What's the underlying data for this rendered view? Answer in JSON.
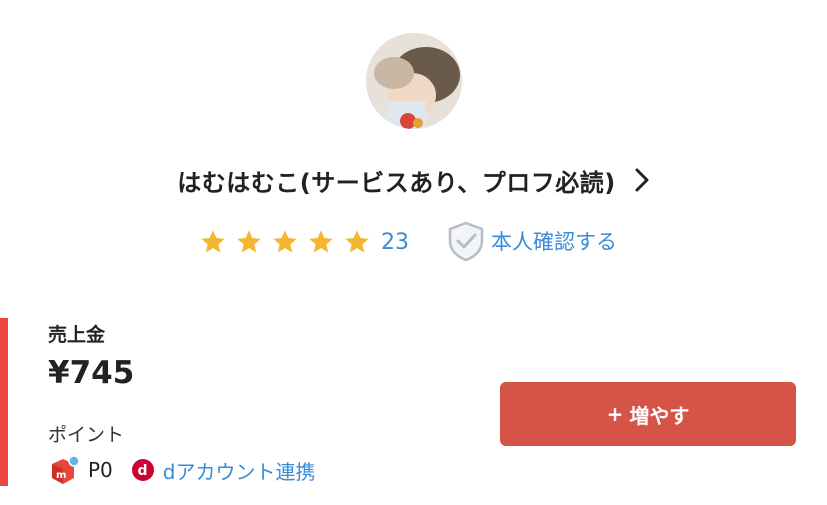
{
  "profile": {
    "avatar_alt": "profile-photo",
    "name": "はむはむこ(サービスあり、プロフ必読)",
    "chevron_icon": "chevron-right-icon"
  },
  "rating": {
    "stars": 5,
    "max_stars": 5,
    "count": "23",
    "star_color": "#f5b731"
  },
  "verification": {
    "icon": "shield-check-icon",
    "label": "本人確認する"
  },
  "sales": {
    "label": "売上金",
    "amount": "¥745"
  },
  "points": {
    "label": "ポイント",
    "icon": "mercari-m-icon",
    "value": "P0",
    "d_icon": "docomo-d-icon",
    "d_link": "dアカウント連携"
  },
  "actions": {
    "increase_plus": "+",
    "increase_label": "増やす",
    "button_color": "#d55347"
  },
  "colors": {
    "accent": "#ef4444",
    "link": "#3a8bd8"
  }
}
